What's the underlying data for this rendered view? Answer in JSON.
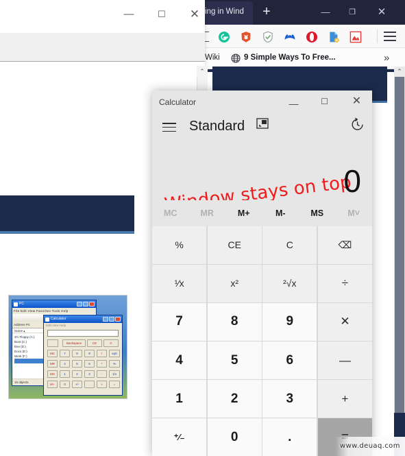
{
  "browser": {
    "tab_title": "ing in Wind",
    "new_tab_label": "+",
    "minimize": "—",
    "maximize": "❐",
    "close": "✕",
    "extensions": [
      {
        "name": "grammarly-extension-icon",
        "glyph": "G",
        "color": "#15c39a"
      },
      {
        "name": "brave-lion-extension-icon",
        "glyph": "",
        "color": "#e2542b"
      },
      {
        "name": "shield-extension-icon",
        "glyph": "",
        "color": "#6fae72"
      },
      {
        "name": "malwarebytes-extension-icon",
        "glyph": "M",
        "color": "#1a5fd0"
      },
      {
        "name": "opera-extension-icon",
        "glyph": "",
        "color": "#e0182d"
      },
      {
        "name": "document-extension-icon",
        "glyph": "",
        "color": "#3e8ed6"
      },
      {
        "name": "pdf-extension-icon",
        "glyph": "",
        "color": "#e03c3c"
      }
    ],
    "menu_label": "≡",
    "bookmarks": {
      "wiki_label": "Wiki",
      "item_label": "9 Simple Ways To Free...",
      "overflow_label": "»"
    }
  },
  "background_window": {
    "minimize": "—",
    "maximize": "☐",
    "close": "✕"
  },
  "thumbnail": {
    "explorer": {
      "title": "PC",
      "menus": "File   Edit   View   Favorites   Tools   Help",
      "address_label": "Address",
      "address_value": "PC",
      "column_header": "Name  ▴",
      "items": [
        "3½ Floppy (A:)",
        "Boot (C:)",
        "Dev (D:)",
        "Docs (E:)",
        "Work (F:)"
      ],
      "status": "15 objects"
    },
    "calculator": {
      "title": "Calculator",
      "menus": "Edit   View   Help",
      "row1": [
        "Backspace",
        "CE",
        "C"
      ],
      "row2": [
        "MC",
        "7",
        "8",
        "9",
        "/",
        "sqrt"
      ],
      "row3": [
        "MR",
        "4",
        "5",
        "6",
        "*",
        "%"
      ],
      "row4": [
        "MS",
        "1",
        "2",
        "3",
        "-",
        "1/x"
      ],
      "row5": [
        "M+",
        "0",
        "+/-",
        ".",
        "+",
        "="
      ]
    }
  },
  "calculator": {
    "title": "Calculator",
    "minimize": "—",
    "maximize": "☐",
    "close": "✕",
    "mode": "Standard",
    "display_value": "0",
    "annotation": "Window stays on top",
    "memory_buttons": [
      {
        "label": "MC",
        "enabled": false
      },
      {
        "label": "MR",
        "enabled": false
      },
      {
        "label": "M+",
        "enabled": true
      },
      {
        "label": "M-",
        "enabled": true
      },
      {
        "label": "MS",
        "enabled": true
      },
      {
        "label": "M˅",
        "enabled": false
      }
    ],
    "keys": [
      {
        "label": "%",
        "name": "percent-key",
        "kind": "fn"
      },
      {
        "label": "CE",
        "name": "clear-entry-key",
        "kind": "fn"
      },
      {
        "label": "C",
        "name": "clear-key",
        "kind": "fn"
      },
      {
        "label": "⌫",
        "name": "backspace-key",
        "kind": "fn"
      },
      {
        "label": "¹⁄x",
        "name": "reciprocal-key",
        "kind": "fn"
      },
      {
        "label": "x²",
        "name": "square-key",
        "kind": "fn"
      },
      {
        "label": "²√x",
        "name": "square-root-key",
        "kind": "fn"
      },
      {
        "label": "÷",
        "name": "divide-key",
        "kind": "op"
      },
      {
        "label": "7",
        "name": "digit-7-key",
        "kind": "num"
      },
      {
        "label": "8",
        "name": "digit-8-key",
        "kind": "num"
      },
      {
        "label": "9",
        "name": "digit-9-key",
        "kind": "num"
      },
      {
        "label": "✕",
        "name": "multiply-key",
        "kind": "op"
      },
      {
        "label": "4",
        "name": "digit-4-key",
        "kind": "num"
      },
      {
        "label": "5",
        "name": "digit-5-key",
        "kind": "num"
      },
      {
        "label": "6",
        "name": "digit-6-key",
        "kind": "num"
      },
      {
        "label": "—",
        "name": "subtract-key",
        "kind": "op"
      },
      {
        "label": "1",
        "name": "digit-1-key",
        "kind": "num"
      },
      {
        "label": "2",
        "name": "digit-2-key",
        "kind": "num"
      },
      {
        "label": "3",
        "name": "digit-3-key",
        "kind": "num"
      },
      {
        "label": "+",
        "name": "add-key",
        "kind": "op"
      },
      {
        "label": "⁺⁄₋",
        "name": "plus-minus-key",
        "kind": "num"
      },
      {
        "label": "0",
        "name": "digit-0-key",
        "kind": "num"
      },
      {
        "label": ".",
        "name": "decimal-key",
        "kind": "num"
      },
      {
        "label": "=",
        "name": "equals-key",
        "kind": "eq"
      }
    ]
  },
  "watermark": "www.deuaq.com",
  "colors": {
    "navy": "#1c2b4d",
    "annotation_red": "#ee1c1c",
    "calc_chrome": "#e6e6e6",
    "equals_grey": "#a6a6a6"
  }
}
